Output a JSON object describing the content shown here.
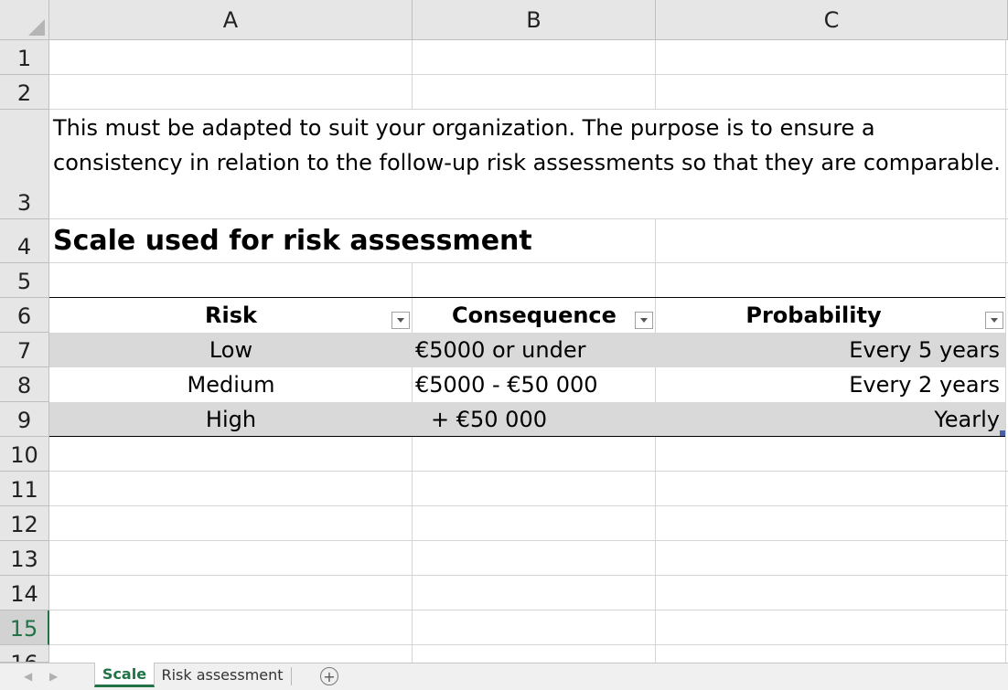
{
  "columns": [
    "A",
    "B",
    "C"
  ],
  "rows": [
    "1",
    "2",
    "3",
    "4",
    "5",
    "6",
    "7",
    "8",
    "9",
    "10",
    "11",
    "12",
    "13",
    "14",
    "15",
    "16"
  ],
  "selected_row": "15",
  "note": "This must be adapted to suit your organization. The purpose is to ensure a consistency in relation to the follow-up risk assessments so that they are comparable.",
  "heading": "Scale used for risk assessment",
  "table": {
    "headers": [
      "Risk",
      "Consequence",
      "Probability"
    ],
    "rows": [
      [
        "Low",
        "€5000 or under",
        "Every 5 years"
      ],
      [
        "Medium",
        "€5000 - €50 000",
        "Every 2 years"
      ],
      [
        "High",
        "+ €50 000",
        "Yearly"
      ]
    ]
  },
  "sheets": [
    {
      "label": "Scale",
      "active": true
    },
    {
      "label": "Risk assessment",
      "active": false
    }
  ],
  "colors": {
    "accent": "#217346",
    "band": "#d9d9d9",
    "header_bg": "#e6e6e6"
  },
  "icons": {
    "prev_sheet": "chevron-left-icon",
    "next_sheet": "chevron-right-icon",
    "add_sheet": "plus-circle-icon",
    "filter": "filter-dropdown-icon"
  }
}
